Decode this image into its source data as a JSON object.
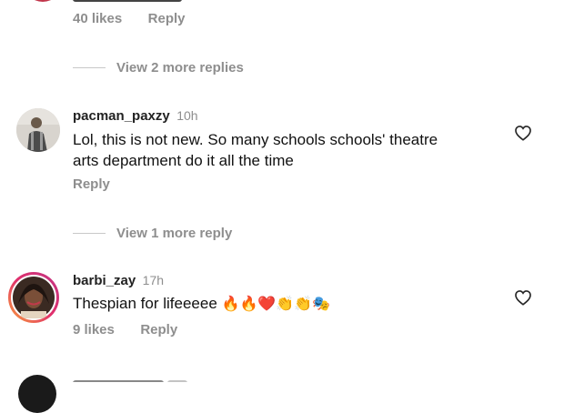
{
  "comments": [
    {
      "likes": "40 likes",
      "reply_label": "Reply",
      "view_more": "View 2 more replies"
    },
    {
      "username": "pacman_paxzy",
      "time": "10h",
      "text_line1": "Lol, this is not new. So many schools schools' theatre",
      "text_line2": "arts department do it all the time",
      "reply_label": "Reply",
      "view_more": "View 1 more reply"
    },
    {
      "username": "barbi_zay",
      "time": "17h",
      "text": "Thespian for lifeeeee",
      "emojis": "🔥🔥❤️👏👏🎭",
      "likes": "9 likes",
      "reply_label": "Reply"
    }
  ],
  "colors": {
    "meta": "#8e8e8e",
    "story_ring_start": "#f9a13a",
    "story_ring_end": "#c13584",
    "top_avatar": "#c1354a"
  },
  "icons": {
    "like": "heart-outline-icon"
  }
}
